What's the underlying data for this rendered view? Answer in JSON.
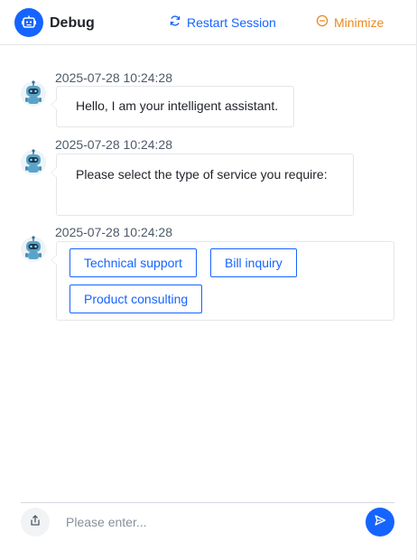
{
  "header": {
    "title": "Debug",
    "restart_label": "Restart Session",
    "minimize_label": "Minimize",
    "icons": {
      "logo": "robot-icon",
      "restart": "refresh-icon",
      "minimize": "minus-circle-icon"
    },
    "colors": {
      "primary": "#1664ff",
      "warning": "#e8891f"
    }
  },
  "messages": [
    {
      "time": "2025-07-28 10:24:28",
      "text": "Hello, I am your intelligent assistant."
    },
    {
      "time": "2025-07-28 10:24:28",
      "text": "Please select the type of service you require:"
    },
    {
      "time": "2025-07-28 10:24:28",
      "options": [
        "Technical support",
        "Bill inquiry",
        "Product consulting"
      ]
    }
  ],
  "composer": {
    "placeholder": "Please enter...",
    "value": "",
    "icons": {
      "upload": "upload-icon",
      "send": "send-icon"
    }
  }
}
